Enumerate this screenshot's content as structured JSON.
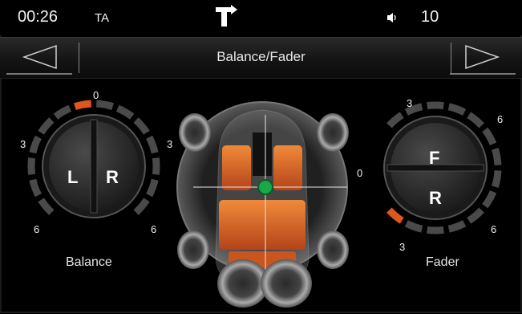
{
  "status": {
    "time": "00:26",
    "ta": "TA",
    "volume": "10",
    "icons": [
      "nav-turn-icon",
      "volume-icon"
    ]
  },
  "header": {
    "title": "Balance/Fader",
    "prev_icon": "left-triangle-icon",
    "next_icon": "right-triangle-icon"
  },
  "balance": {
    "label": "Balance",
    "left": "L",
    "right": "R",
    "scale_top": "0",
    "scale_mid": "3",
    "scale_bottom_left": "6",
    "scale_bottom_right": "6"
  },
  "center": {
    "scale_label": "3"
  },
  "fader": {
    "label": "Fader",
    "front": "F",
    "rear": "R",
    "scale_top": "3",
    "scale_top_right": "6",
    "scale_mid": "0",
    "scale_bottom_left": "3",
    "scale_bottom_right": "6"
  },
  "colors": {
    "accent": "#e0561c",
    "segment": "#4a4a4a",
    "knob": "#2b2b2b"
  }
}
